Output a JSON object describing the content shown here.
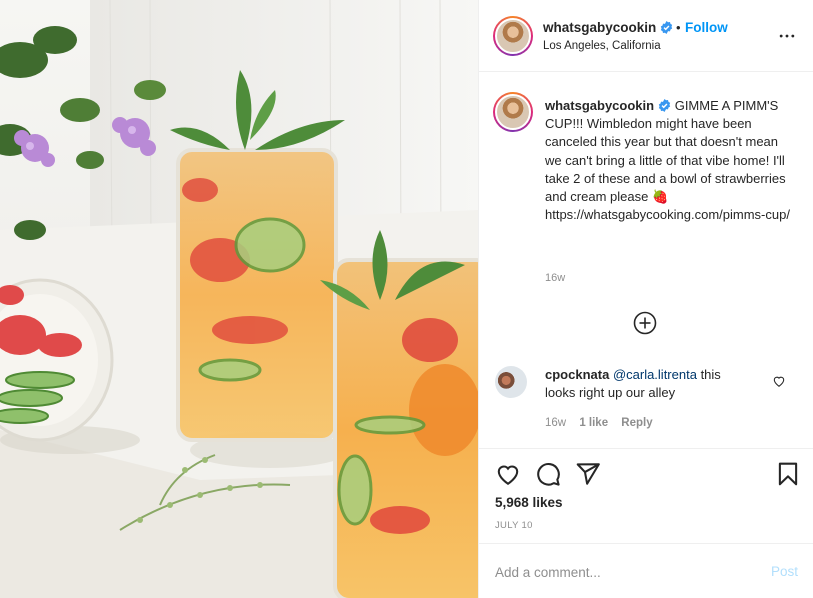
{
  "post": {
    "username": "whatsgabycookin",
    "follow_label": "Follow",
    "separator": "•",
    "location": "Los Angeles, California",
    "caption_text": "GIMME A PIMM'S CUP!!! Wimbledon might have been canceled this year but that doesn't mean we can't bring a little of that vibe home! I'll take 2 of these and a bowl of strawberries and cream please 🍓 https://whatsgabycooking.com/pimms-cup/",
    "caption_time": "16w",
    "likes": "5,968 likes",
    "date": "JULY 10"
  },
  "comment": {
    "username": "cpocknata",
    "mention": "@carla.litrenta",
    "text": " this looks right up our alley",
    "time": "16w",
    "likes": "1 like",
    "reply_label": "Reply"
  },
  "add_comment": {
    "placeholder": "Add a comment...",
    "post_label": "Post"
  },
  "icons": {
    "verified": "verified-badge-icon",
    "more": "more-options-icon",
    "load_more": "plus-circle-icon",
    "like": "heart-icon",
    "comment": "comment-bubble-icon",
    "share": "paper-plane-icon",
    "save": "bookmark-icon"
  },
  "colors": {
    "accent": "#0095f6",
    "mention": "#00376b",
    "muted": "#8e8e8e",
    "post_disabled": "#b2dffc"
  }
}
